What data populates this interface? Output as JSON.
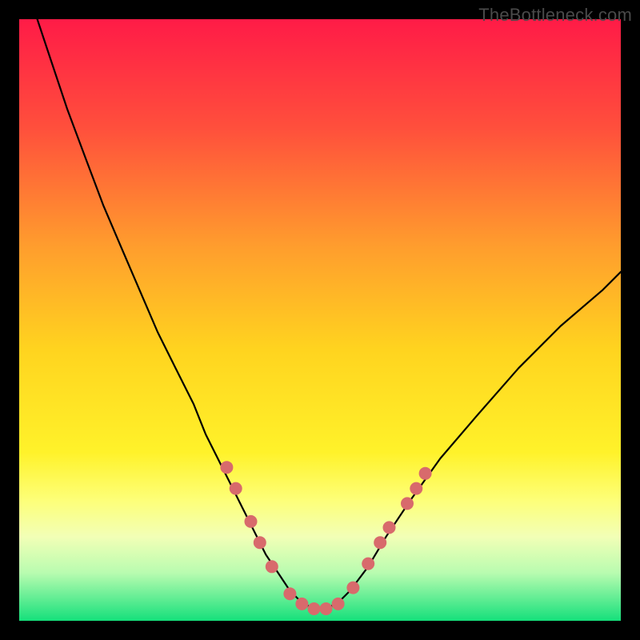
{
  "watermark": "TheBottleneck.com",
  "chart_data": {
    "type": "line",
    "title": "",
    "xlabel": "",
    "ylabel": "",
    "xlim": [
      0,
      100
    ],
    "ylim": [
      0,
      100
    ],
    "grid": false,
    "legend": false,
    "background_gradient": {
      "stops": [
        {
          "offset": 0.0,
          "color": "#ff1b47"
        },
        {
          "offset": 0.18,
          "color": "#ff4f3c"
        },
        {
          "offset": 0.38,
          "color": "#ff9e2d"
        },
        {
          "offset": 0.55,
          "color": "#ffd41f"
        },
        {
          "offset": 0.72,
          "color": "#fff22a"
        },
        {
          "offset": 0.8,
          "color": "#fdff79"
        },
        {
          "offset": 0.86,
          "color": "#f2ffb6"
        },
        {
          "offset": 0.92,
          "color": "#b9fcb0"
        },
        {
          "offset": 1.0,
          "color": "#15e07b"
        }
      ]
    },
    "series": [
      {
        "name": "bottleneck-curve",
        "color": "#000000",
        "stroke_width": 2.2,
        "x": [
          3,
          5,
          8,
          11,
          14,
          17,
          20,
          23,
          26,
          29,
          31,
          33,
          35,
          37,
          39,
          41,
          43,
          45,
          47,
          49,
          51,
          53,
          55,
          58,
          61,
          65,
          70,
          76,
          83,
          90,
          97,
          100
        ],
        "y": [
          100,
          94,
          85,
          77,
          69,
          62,
          55,
          48,
          42,
          36,
          31,
          27,
          23,
          19,
          15,
          11,
          8,
          5,
          3,
          2,
          2,
          3,
          5,
          9,
          14,
          20,
          27,
          34,
          42,
          49,
          55,
          58
        ]
      }
    ],
    "markers": {
      "name": "highlight-dots",
      "color": "#d86a6c",
      "radius": 8,
      "points": [
        {
          "x": 34.5,
          "y": 25.5
        },
        {
          "x": 36.0,
          "y": 22.0
        },
        {
          "x": 38.5,
          "y": 16.5
        },
        {
          "x": 40.0,
          "y": 13.0
        },
        {
          "x": 42.0,
          "y": 9.0
        },
        {
          "x": 45.0,
          "y": 4.5
        },
        {
          "x": 47.0,
          "y": 2.8
        },
        {
          "x": 49.0,
          "y": 2.0
        },
        {
          "x": 51.0,
          "y": 2.0
        },
        {
          "x": 53.0,
          "y": 2.8
        },
        {
          "x": 55.5,
          "y": 5.5
        },
        {
          "x": 58.0,
          "y": 9.5
        },
        {
          "x": 60.0,
          "y": 13.0
        },
        {
          "x": 61.5,
          "y": 15.5
        },
        {
          "x": 64.5,
          "y": 19.5
        },
        {
          "x": 66.0,
          "y": 22.0
        },
        {
          "x": 67.5,
          "y": 24.5
        }
      ]
    }
  }
}
